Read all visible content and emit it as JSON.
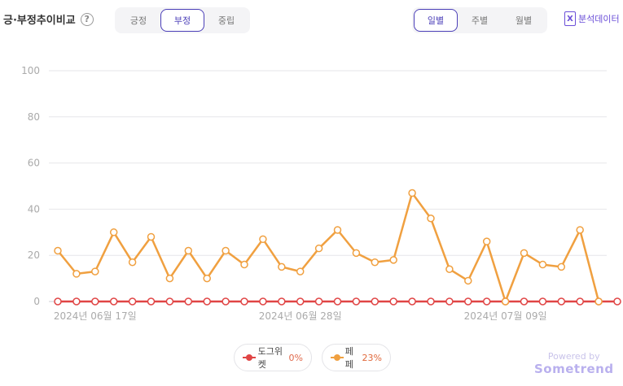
{
  "header": {
    "title": "긍·부정추이비교",
    "help_icon": "?"
  },
  "sentiment_tabs": [
    {
      "label": "긍정",
      "active": false
    },
    {
      "label": "부정",
      "active": true
    },
    {
      "label": "중립",
      "active": false
    }
  ],
  "period_tabs": [
    {
      "label": "일별",
      "active": true
    },
    {
      "label": "주별",
      "active": false
    },
    {
      "label": "월별",
      "active": false
    }
  ],
  "export": {
    "icon": "excel-icon",
    "icon_glyph": "X",
    "label": "분석데이터"
  },
  "legend": [
    {
      "name": "도그위켓",
      "pct": "0%",
      "color": "#e04545",
      "pct_color": "#e0684a"
    },
    {
      "name": "페페",
      "pct": "23%",
      "color": "#f0a040",
      "pct_color": "#e0683a"
    }
  ],
  "powered": {
    "line1": "Powered by",
    "line2": "Sometrend"
  },
  "chart_data": {
    "type": "line",
    "ylim": [
      0,
      100
    ],
    "yticks": [
      0,
      20,
      40,
      60,
      80,
      100
    ],
    "x_tick_labels": [
      {
        "index": 2,
        "label": "2024년 06월 17일"
      },
      {
        "index": 13,
        "label": "2024년 06월 28일"
      },
      {
        "index": 24,
        "label": "2024년 07월 09일"
      }
    ],
    "grid": true,
    "series": [
      {
        "name": "도그위켓",
        "color": "#e04545",
        "values": [
          0,
          0,
          0,
          0,
          0,
          0,
          0,
          0,
          0,
          0,
          0,
          0,
          0,
          0,
          0,
          0,
          0,
          0,
          0,
          0,
          0,
          0,
          0,
          0,
          0,
          0,
          0,
          0,
          0,
          0,
          0
        ]
      },
      {
        "name": "페페",
        "color": "#f0a040",
        "values": [
          22,
          12,
          13,
          30,
          17,
          28,
          10,
          22,
          10,
          22,
          16,
          27,
          15,
          13,
          23,
          31,
          21,
          17,
          18,
          47,
          36,
          14,
          9,
          26,
          0,
          21,
          16,
          15,
          31,
          0
        ]
      }
    ]
  }
}
